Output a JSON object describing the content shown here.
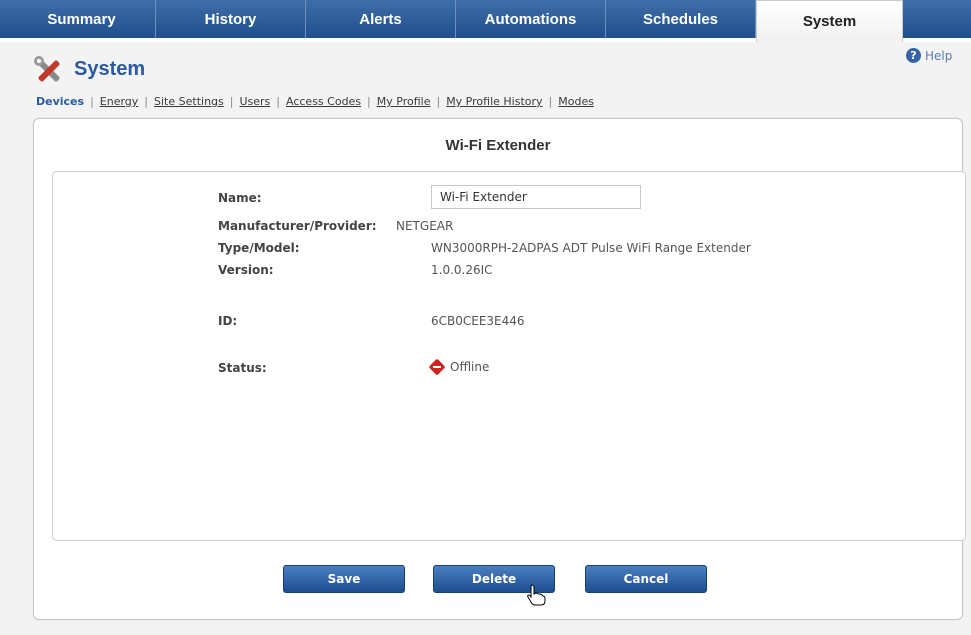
{
  "tabs": [
    {
      "label": "Summary",
      "active": false
    },
    {
      "label": "History",
      "active": false
    },
    {
      "label": "Alerts",
      "active": false
    },
    {
      "label": "Automations",
      "active": false
    },
    {
      "label": "Schedules",
      "active": false
    },
    {
      "label": "System",
      "active": true
    }
  ],
  "header": {
    "title": "System",
    "help_label": "Help",
    "icon": "tools-icon"
  },
  "subnav": {
    "items": [
      "Devices",
      "Energy",
      "Site Settings",
      "Users",
      "Access Codes",
      "My Profile",
      "My Profile History",
      "Modes"
    ],
    "current": "Devices",
    "separator": "|"
  },
  "device": {
    "panel_title": "Wi-Fi Extender",
    "fields": {
      "name_label": "Name:",
      "name_value": "Wi-Fi Extender",
      "manufacturer_label": "Manufacturer/Provider:",
      "manufacturer_value": "NETGEAR",
      "type_label": "Type/Model:",
      "type_value": "WN3000RPH-2ADPAS ADT Pulse WiFi Range Extender",
      "version_label": "Version:",
      "version_value": "1.0.0.26IC",
      "id_label": "ID:",
      "id_value": "6CB0CEE3E446",
      "status_label": "Status:",
      "status_value": "Offline"
    },
    "status_color": "#cc2222"
  },
  "buttons": {
    "save": "Save",
    "delete": "Delete",
    "cancel": "Cancel"
  },
  "colors": {
    "tab_bar": "#1f4f8c",
    "accent": "#2b5aa0",
    "button": "#1d4e8f"
  }
}
